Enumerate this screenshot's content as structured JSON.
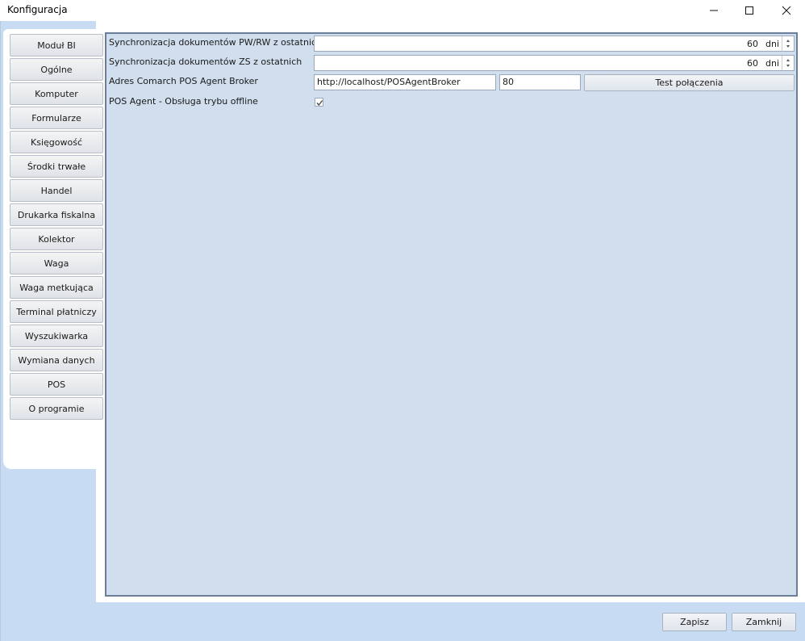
{
  "window": {
    "title": "Konfiguracja"
  },
  "nav": {
    "items": [
      {
        "label": "Moduł BI"
      },
      {
        "label": "Ogólne"
      },
      {
        "label": "Komputer"
      },
      {
        "label": "Formularze"
      },
      {
        "label": "Księgowość"
      },
      {
        "label": "Środki trwałe"
      },
      {
        "label": "Handel"
      },
      {
        "label": "Drukarka fiskalna"
      },
      {
        "label": "Kolektor"
      },
      {
        "label": "Waga"
      },
      {
        "label": "Waga metkująca"
      },
      {
        "label": "Terminal płatniczy"
      },
      {
        "label": "Wyszukiwarka"
      },
      {
        "label": "Wymiana danych"
      },
      {
        "label": "POS"
      },
      {
        "label": "O programie"
      }
    ]
  },
  "settings": {
    "sync_pwrw": {
      "label": "Synchronizacja dokumentów PW/RW z ostatnich",
      "value": "60",
      "unit": "dni"
    },
    "sync_zs": {
      "label": "Synchronizacja dokumentów ZS z ostatnich",
      "value": "60",
      "unit": "dni"
    },
    "broker": {
      "label": "Adres Comarch POS Agent Broker",
      "url": "http://localhost/POSAgentBroker",
      "port": "80",
      "test_label": "Test połączenia"
    },
    "offline": {
      "label": "POS Agent - Obsługa trybu offline",
      "checked": true
    }
  },
  "footer": {
    "save_label": "Zapisz",
    "close_label": "Zamknij"
  }
}
